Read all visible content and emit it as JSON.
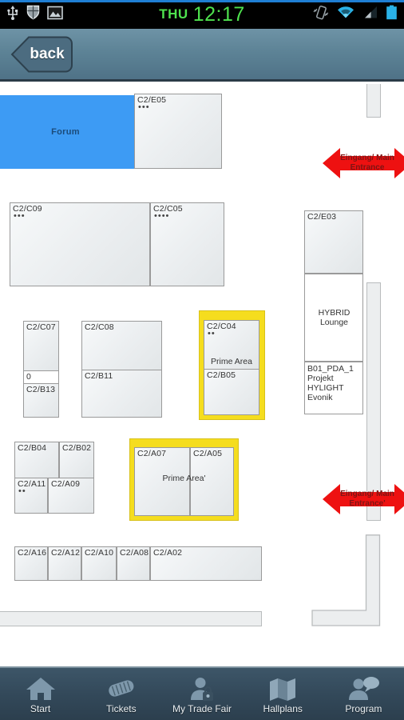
{
  "statusbar": {
    "day": "THU",
    "time": "12:17",
    "left_icons": [
      "usb-icon",
      "shield-icon",
      "image-icon"
    ],
    "right_icons": [
      "vibrate-icon",
      "wifi-icon",
      "signal-icon",
      "battery-icon"
    ],
    "clock_color": "#4ee24e",
    "background": "#000000"
  },
  "header": {
    "back_label": "back",
    "background": "#5d8396"
  },
  "map": {
    "forum": {
      "label": "Forum",
      "color": "#3d9bf4"
    },
    "prime_area_label_1": "Prime Area",
    "prime_area_label_2": "Prime Area'",
    "prime_frame_color": "#f5dd1e",
    "entrances": [
      {
        "label": "Eingang/ Main Entrance",
        "color": "#ee1111"
      },
      {
        "label": "Eingang/ Main Entrance'",
        "color": "#ee1111"
      }
    ],
    "stands": [
      {
        "code": "C2/E05",
        "dots": "•••"
      },
      {
        "code": "C2/C09",
        "dots": "•••"
      },
      {
        "code": "C2/C05",
        "dots": "••••"
      },
      {
        "code": "C2/C07",
        "dots": ""
      },
      {
        "code": "0",
        "dots": ""
      },
      {
        "code": "C2/B13",
        "dots": ""
      },
      {
        "code": "C2/C08",
        "dots": ""
      },
      {
        "code": "C2/B11",
        "dots": ""
      },
      {
        "code": "C2/C04",
        "dots": "••"
      },
      {
        "code": "C2/B05",
        "dots": ""
      },
      {
        "code": "C2/B04",
        "dots": ""
      },
      {
        "code": "C2/B02",
        "dots": ""
      },
      {
        "code": "C2/A11",
        "dots": "••"
      },
      {
        "code": "C2/A09",
        "dots": ""
      },
      {
        "code": "C2/A07",
        "dots": ""
      },
      {
        "code": "C2/A05",
        "dots": ""
      },
      {
        "code": "C2/A16",
        "dots": ""
      },
      {
        "code": "C2/A12",
        "dots": ""
      },
      {
        "code": "C2/A10",
        "dots": ""
      },
      {
        "code": "C2/A08",
        "dots": ""
      },
      {
        "code": "C2/A02",
        "dots": ""
      },
      {
        "code": "C2/E03",
        "dots": ""
      }
    ],
    "east_block": {
      "code": "C2/E03",
      "lounge": "HYBRID Lounge",
      "project": "B01_PDA_1 Projekt HYLIGHT Evonik"
    }
  },
  "tabbar": {
    "items": [
      {
        "label": "Start",
        "icon": "home-icon"
      },
      {
        "label": "Tickets",
        "icon": "ticket-icon"
      },
      {
        "label": "My Trade Fair",
        "icon": "user-lock-icon"
      },
      {
        "label": "Hallplans",
        "icon": "map-icon"
      },
      {
        "label": "Program",
        "icon": "user-chat-icon"
      }
    ]
  }
}
